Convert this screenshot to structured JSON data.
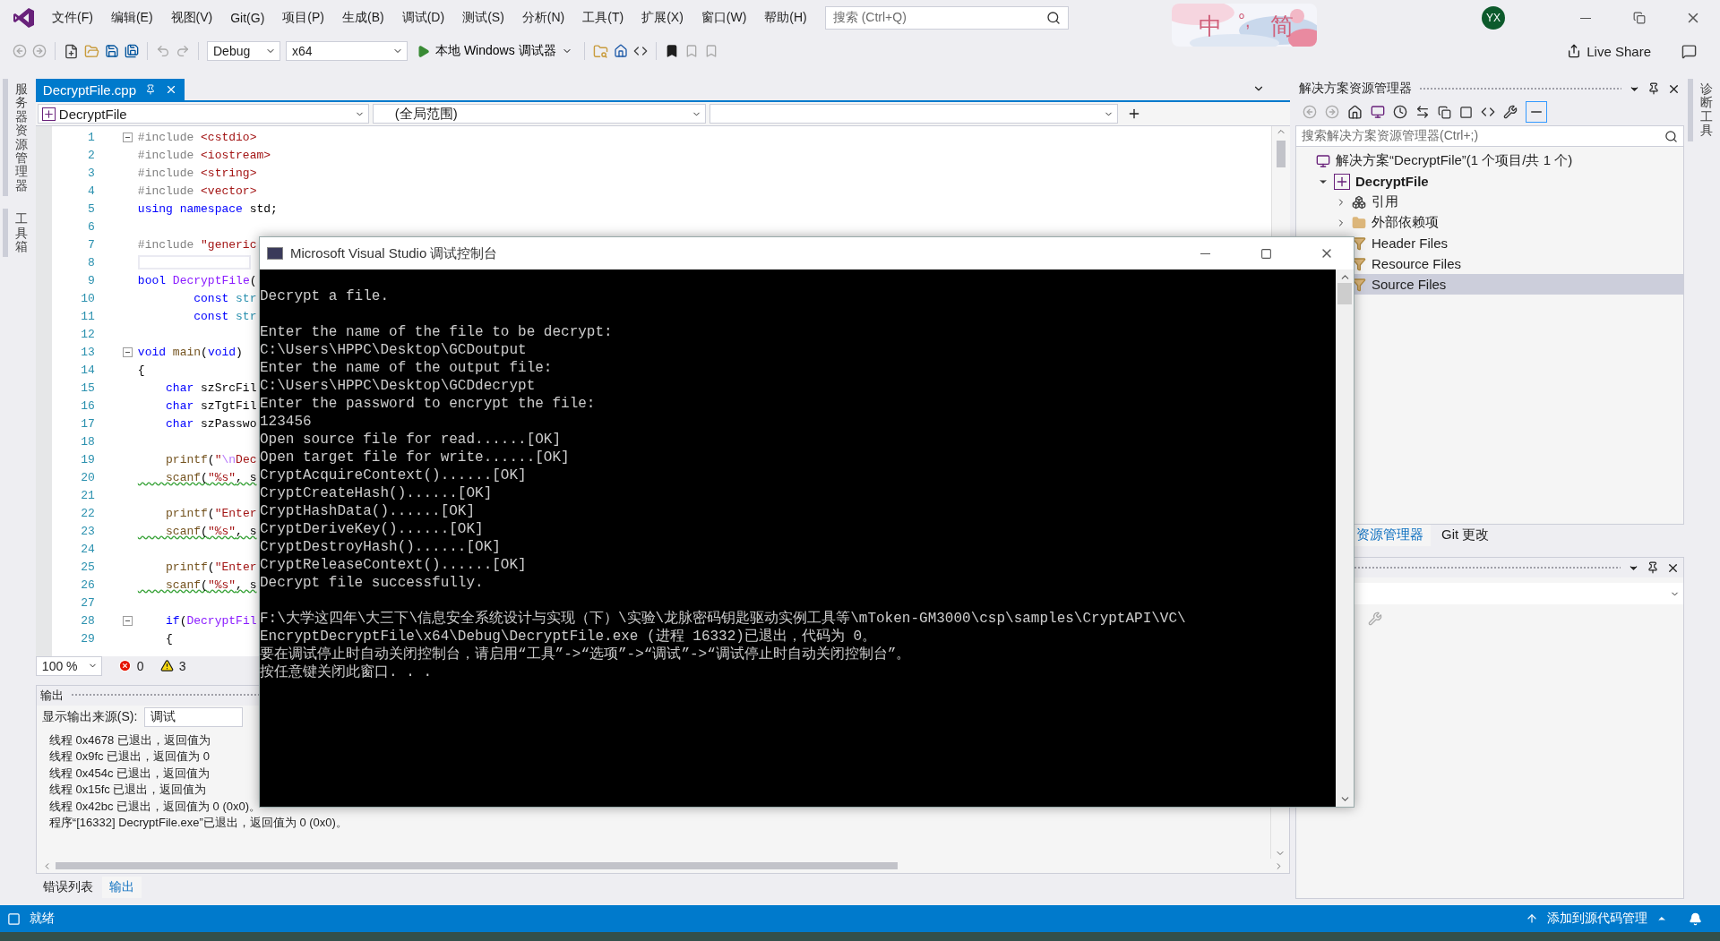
{
  "menu_bar": {
    "items": [
      "文件(F)",
      "编辑(E)",
      "视图(V)",
      "Git(G)",
      "项目(P)",
      "生成(B)",
      "调试(D)",
      "测试(S)",
      "分析(N)",
      "工具(T)",
      "扩展(X)",
      "窗口(W)",
      "帮助(H)"
    ]
  },
  "search": {
    "placeholder": "搜索 (Ctrl+Q)"
  },
  "ime": {
    "mode": "中",
    "punctuation": "°,",
    "script": "简"
  },
  "account": {
    "initials": "YX"
  },
  "toolbar": {
    "configuration": "Debug",
    "platform": "x64",
    "debugger": "本地 Windows 调试器",
    "live_share": "Live Share"
  },
  "left_strip": [
    "服务器资源管理器",
    "工具箱"
  ],
  "editor": {
    "tabs": [
      {
        "label": "DecryptFile.cpp",
        "selected": true
      }
    ],
    "nav": {
      "project": "DecryptFile",
      "scope": "(全局范围)"
    },
    "lines": [
      {
        "n": "1",
        "fold": true,
        "current": false,
        "squiggle": false,
        "segs": [
          {
            "text": "#include",
            "kind": "pre"
          },
          {
            "text": " <cstdio>",
            "kind": "str"
          }
        ]
      },
      {
        "n": "2",
        "fold": false,
        "current": false,
        "squiggle": false,
        "segs": [
          {
            "text": "#include",
            "kind": "pre"
          },
          {
            "text": " <iostream>",
            "kind": "str"
          }
        ]
      },
      {
        "n": "3",
        "fold": false,
        "current": false,
        "squiggle": false,
        "segs": [
          {
            "text": "#include",
            "kind": "pre"
          },
          {
            "text": " <string>",
            "kind": "str"
          }
        ]
      },
      {
        "n": "4",
        "fold": false,
        "current": false,
        "squiggle": false,
        "segs": [
          {
            "text": "#include",
            "kind": "pre"
          },
          {
            "text": " <vector>",
            "kind": "str"
          }
        ]
      },
      {
        "n": "5",
        "fold": false,
        "current": false,
        "squiggle": false,
        "segs": [
          {
            "text": "using",
            "kind": "kw"
          },
          {
            "text": " namespace",
            "kind": "kw"
          },
          {
            "text": " std;",
            "kind": "txt"
          }
        ]
      },
      {
        "n": "6",
        "fold": false,
        "current": false
      },
      {
        "n": "7",
        "fold": false,
        "current": false,
        "squiggle": false,
        "segs": [
          {
            "text": "#include",
            "kind": "pre"
          },
          {
            "text": " \"generic",
            "kind": "str"
          }
        ]
      },
      {
        "n": "8",
        "fold": false,
        "current": true
      },
      {
        "n": "9",
        "fold": false,
        "current": false,
        "squiggle": false,
        "segs": [
          {
            "text": "bool",
            "kind": "kw"
          },
          {
            "text": " DecryptFile",
            "kind": "mf"
          },
          {
            "text": "(",
            "kind": "txt"
          }
        ]
      },
      {
        "n": "10",
        "fold": false,
        "current": false,
        "squiggle": false,
        "segs": [
          {
            "text": "        const",
            "kind": "kw"
          },
          {
            "text": " str",
            "kind": "ty"
          }
        ]
      },
      {
        "n": "11",
        "fold": false,
        "current": false,
        "squiggle": false,
        "segs": [
          {
            "text": "        const",
            "kind": "kw"
          },
          {
            "text": " str",
            "kind": "ty"
          }
        ]
      },
      {
        "n": "12",
        "fold": false,
        "current": false
      },
      {
        "n": "13",
        "fold": true,
        "current": false,
        "squiggle": false,
        "segs": [
          {
            "text": "void",
            "kind": "kw"
          },
          {
            "text": " main",
            "kind": "fn"
          },
          {
            "text": "(",
            "kind": "txt"
          },
          {
            "text": "void",
            "kind": "kw"
          },
          {
            "text": ")",
            "kind": "txt"
          }
        ]
      },
      {
        "n": "14",
        "fold": false,
        "current": false,
        "squiggle": false,
        "segs": [
          {
            "text": "{",
            "kind": "txt"
          }
        ]
      },
      {
        "n": "15",
        "fold": false,
        "current": false,
        "squiggle": false,
        "segs": [
          {
            "text": "    char",
            "kind": "kw"
          },
          {
            "text": " szSrcFil",
            "kind": "txt"
          }
        ]
      },
      {
        "n": "16",
        "fold": false,
        "current": false,
        "squiggle": false,
        "segs": [
          {
            "text": "    char",
            "kind": "kw"
          },
          {
            "text": " szTgtFil",
            "kind": "txt"
          }
        ]
      },
      {
        "n": "17",
        "fold": false,
        "current": false,
        "squiggle": false,
        "segs": [
          {
            "text": "    char",
            "kind": "kw"
          },
          {
            "text": " szPasswo",
            "kind": "txt"
          }
        ]
      },
      {
        "n": "18",
        "fold": false,
        "current": false
      },
      {
        "n": "19",
        "fold": false,
        "current": false,
        "squiggle": false,
        "segs": [
          {
            "text": "    printf",
            "kind": "fn"
          },
          {
            "text": "(",
            "kind": "txt"
          },
          {
            "text": "\"",
            "kind": "str"
          },
          {
            "text": "\\n",
            "kind": "esc"
          },
          {
            "text": "Dec",
            "kind": "str"
          }
        ]
      },
      {
        "n": "20",
        "fold": false,
        "current": false,
        "squiggle": true,
        "segs": [
          {
            "text": "    scanf",
            "kind": "fn"
          },
          {
            "text": "(",
            "kind": "txt"
          },
          {
            "text": "\"%s\"",
            "kind": "str"
          },
          {
            "text": ", s",
            "kind": "txt"
          }
        ]
      },
      {
        "n": "21",
        "fold": false,
        "current": false
      },
      {
        "n": "22",
        "fold": false,
        "current": false,
        "squiggle": false,
        "segs": [
          {
            "text": "    printf",
            "kind": "fn"
          },
          {
            "text": "(",
            "kind": "txt"
          },
          {
            "text": "\"Enter",
            "kind": "str"
          }
        ]
      },
      {
        "n": "23",
        "fold": false,
        "current": false,
        "squiggle": true,
        "segs": [
          {
            "text": "    scanf",
            "kind": "fn"
          },
          {
            "text": "(",
            "kind": "txt"
          },
          {
            "text": "\"%s\"",
            "kind": "str"
          },
          {
            "text": ", s",
            "kind": "txt"
          }
        ]
      },
      {
        "n": "24",
        "fold": false,
        "current": false
      },
      {
        "n": "25",
        "fold": false,
        "current": false,
        "squiggle": false,
        "segs": [
          {
            "text": "    printf",
            "kind": "fn"
          },
          {
            "text": "(",
            "kind": "txt"
          },
          {
            "text": "\"Enter",
            "kind": "str"
          }
        ]
      },
      {
        "n": "26",
        "fold": false,
        "current": false,
        "squiggle": true,
        "segs": [
          {
            "text": "    scanf",
            "kind": "fn"
          },
          {
            "text": "(",
            "kind": "txt"
          },
          {
            "text": "\"%s\"",
            "kind": "str"
          },
          {
            "text": ", s",
            "kind": "txt"
          }
        ]
      },
      {
        "n": "27",
        "fold": false,
        "current": false
      },
      {
        "n": "28",
        "fold": true,
        "current": false,
        "squiggle": false,
        "segs": [
          {
            "text": "    if",
            "kind": "kw"
          },
          {
            "text": "(",
            "kind": "txt"
          },
          {
            "text": "DecryptFil",
            "kind": "mf"
          }
        ]
      },
      {
        "n": "29",
        "fold": false,
        "current": false,
        "squiggle": false,
        "segs": [
          {
            "text": "    {",
            "kind": "txt"
          }
        ]
      }
    ],
    "zoom": "100 %",
    "errors": "0",
    "warnings": "3"
  },
  "output": {
    "title": "输出",
    "source_label": "显示输出来源(S):",
    "source": "调试",
    "lines": [
      "线程 0x4678 已退出，返回值为",
      "线程 0x9fc 已退出，返回值为 0",
      "线程 0x454c 已退出，返回值为",
      "线程 0x15fc 已退出，返回值为",
      "线程 0x42bc 已退出，返回值为 0 (0x0)。",
      "程序“[16332] DecryptFile.exe”已退出，返回值为 0 (0x0)。"
    ]
  },
  "bottom_tabs": [
    {
      "label": "错误列表",
      "selected": false
    },
    {
      "label": "输出",
      "selected": true
    }
  ],
  "solution_explorer": {
    "title": "解决方案资源管理器",
    "search": {
      "placeholder": "搜索解决方案资源管理器(Ctrl+;)"
    },
    "tree": [
      {
        "label": "解决方案“DecryptFile”(1 个项目/共 1 个)",
        "kind": "solution",
        "selected": false,
        "children": [
          {
            "label": "DecryptFile",
            "kind": "project",
            "expanded": true,
            "selected": false,
            "children": [
              {
                "label": "引用",
                "kind": "references",
                "expanded": false,
                "selected": false
              },
              {
                "label": "外部依赖项",
                "kind": "external",
                "expanded": false,
                "selected": false
              },
              {
                "label": "Header Files",
                "kind": "filter",
                "selected": false
              },
              {
                "label": "Resource Files",
                "kind": "filter",
                "selected": false
              },
              {
                "label": "Source Files",
                "kind": "filter",
                "selected": true
              }
            ]
          }
        ]
      }
    ]
  },
  "explorer_tabs": [
    {
      "label": "资源管理器",
      "selected": true
    },
    {
      "label": "Git 更改",
      "selected": false
    }
  ],
  "right_strip": [
    "诊断工具"
  ],
  "status_bar": {
    "state": "就绪",
    "source_control": "添加到源代码管理"
  },
  "console": {
    "title": "Microsoft Visual Studio 调试控制台",
    "blocks": [
      [
        "Decrypt a file."
      ],
      [
        "Enter the name of the file to be decrypt:",
        "C:\\Users\\HPPC\\Desktop\\GCDoutput",
        "Enter the name of the output file:",
        "C:\\Users\\HPPC\\Desktop\\GCDdecrypt",
        "Enter the password to encrypt the file:",
        "123456",
        "Open source file for read......[OK]",
        "Open target file for write......[OK]",
        "CryptAcquireContext()......[OK]",
        "CryptCreateHash()......[OK]",
        "CryptHashData()......[OK]",
        "CryptDeriveKey()......[OK]",
        "CryptDestroyHash()......[OK]",
        "CryptReleaseContext()......[OK]",
        "Decrypt file successfully."
      ],
      [
        "F:\\大学这四年\\大三下\\信息安全系统设计与实现（下）\\实验\\龙脉密码钥匙驱动实例工具等\\mToken-GM3000\\csp\\samples\\CryptAPI\\VC\\",
        "EncryptDecryptFile\\x64\\Debug\\DecryptFile.exe (进程 16332)已退出，代码为 0。",
        "要在调试停止时自动关闭控制台，请启用“工具”->“选项”->“调试”->“调试停止时自动关闭控制台”。",
        "按任意键关闭此窗口. . ."
      ]
    ]
  }
}
